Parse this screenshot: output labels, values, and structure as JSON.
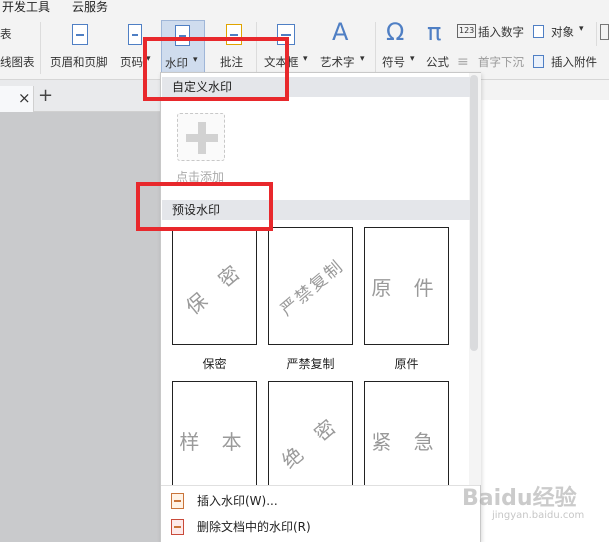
{
  "menubar": {
    "items": [
      "开发工具",
      "云服务"
    ]
  },
  "ribbon": {
    "left_cut_top": "表",
    "left_cut_bottom": "线图表",
    "header_footer": "页眉和页脚",
    "page_number": "页码",
    "watermark": "水印",
    "comment": "批注",
    "textbox": "文本框",
    "wordart": "艺术字",
    "symbol": "符号",
    "formula": "公式",
    "insert_number": "插入数字",
    "object": "对象",
    "drop_cap": "首字下沉",
    "insert_attachment": "插入附件",
    "dropdown_arrow": "▾"
  },
  "tabs": {
    "close": "×",
    "add": "+"
  },
  "panel": {
    "custom_header": "自定义水印",
    "add_label": "点击添加",
    "preset_header": "预设水印",
    "presets": [
      {
        "text": "保 密",
        "caption": "保密",
        "style": "diag"
      },
      {
        "text": "严禁复制",
        "caption": "严禁复制",
        "style": "diag-small"
      },
      {
        "text": "原 件",
        "caption": "原件",
        "style": "flat"
      },
      {
        "text": "样 本",
        "caption": "",
        "style": "flat"
      },
      {
        "text": "绝 密",
        "caption": "",
        "style": "diag"
      },
      {
        "text": "紧 急",
        "caption": "",
        "style": "flat"
      }
    ],
    "insert_watermark": "插入水印(W)...",
    "delete_watermark": "删除文档中的水印(R)"
  },
  "site_watermark": {
    "logo": "Baidu经验",
    "url": "jingyan.baidu.com"
  },
  "colors": {
    "highlight": "#e8282c",
    "accent": "#4f7fc4"
  }
}
